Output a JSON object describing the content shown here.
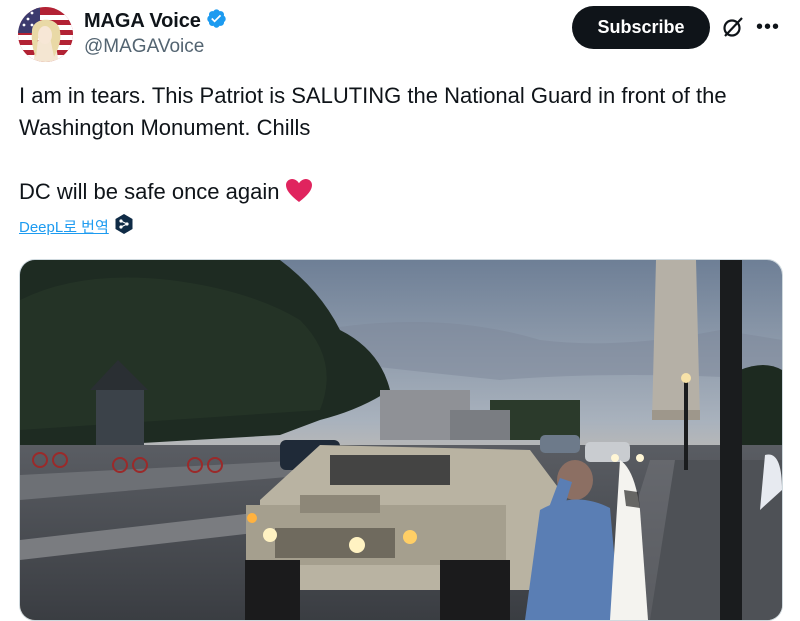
{
  "author": {
    "display_name": "MAGA Voice",
    "handle": "@MAGAVoice",
    "verified": true
  },
  "actions": {
    "subscribe_label": "Subscribe",
    "grok_icon": "grok-icon",
    "more_icon": "more-icon"
  },
  "tweet": {
    "text_line1": "I am in tears. This Patriot is SALUTING the National Guard in front of the Washington Monument. Chills",
    "text_line2": "DC will be safe once again",
    "emoji": "red-heart"
  },
  "translate": {
    "label": "DeepL로 번역",
    "icon": "deepl-icon"
  },
  "colors": {
    "accent": "#1d9bf0",
    "verified": "#1d9bf0",
    "heart": "#e0245e"
  }
}
